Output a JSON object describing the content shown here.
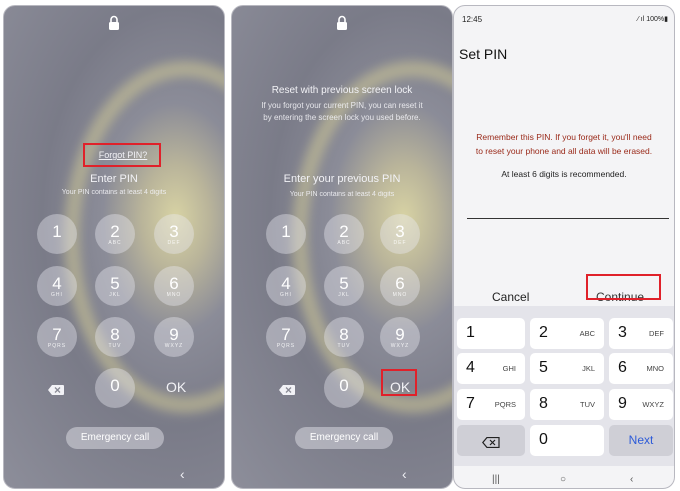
{
  "screen1": {
    "forgot_pin": "Forgot PIN?",
    "enter_pin": "Enter PIN",
    "pin_desc": "Your PIN contains at least 4 digits",
    "keys": [
      {
        "num": "1",
        "letters": ""
      },
      {
        "num": "2",
        "letters": "ABC"
      },
      {
        "num": "3",
        "letters": "DEF"
      },
      {
        "num": "4",
        "letters": "GHI"
      },
      {
        "num": "5",
        "letters": "JKL"
      },
      {
        "num": "6",
        "letters": "MNO"
      },
      {
        "num": "7",
        "letters": "PQRS"
      },
      {
        "num": "8",
        "letters": "TUV"
      },
      {
        "num": "9",
        "letters": "WXYZ"
      },
      {
        "num": "0",
        "letters": ""
      }
    ],
    "ok": "OK",
    "emergency": "Emergency call",
    "back": "‹"
  },
  "screen2": {
    "reset_title": "Reset with previous screen lock",
    "reset_desc_1": "If you forgot your current PIN, you can reset it",
    "reset_desc_2": "by entering the screen lock you used before.",
    "enter_prev": "Enter your previous PIN",
    "pin_desc": "Your PIN contains at least 4 digits",
    "keys": [
      {
        "num": "1",
        "letters": ""
      },
      {
        "num": "2",
        "letters": "ABC"
      },
      {
        "num": "3",
        "letters": "DEF"
      },
      {
        "num": "4",
        "letters": "GHI"
      },
      {
        "num": "5",
        "letters": "JKL"
      },
      {
        "num": "6",
        "letters": "MNO"
      },
      {
        "num": "7",
        "letters": "PQRS"
      },
      {
        "num": "8",
        "letters": "TUV"
      },
      {
        "num": "9",
        "letters": "WXYZ"
      },
      {
        "num": "0",
        "letters": ""
      }
    ],
    "ok": "OK",
    "emergency": "Emergency call",
    "back": "‹"
  },
  "screen3": {
    "time": "12:45",
    "status_right": "⁄ ıl 100%▮",
    "title": "Set PIN",
    "warning_line1": "Remember this PIN. If you forget it, you'll need",
    "warning_line2": "to reset your phone and all data will be erased.",
    "hint": "At least 6 digits is recommended.",
    "cancel": "Cancel",
    "continue": "Continue",
    "keys": [
      {
        "num": "1",
        "letters": ""
      },
      {
        "num": "2",
        "letters": "ABC"
      },
      {
        "num": "3",
        "letters": "DEF"
      },
      {
        "num": "4",
        "letters": "GHI"
      },
      {
        "num": "5",
        "letters": "JKL"
      },
      {
        "num": "6",
        "letters": "MNO"
      },
      {
        "num": "7",
        "letters": "PQRS"
      },
      {
        "num": "8",
        "letters": "TUV"
      },
      {
        "num": "9",
        "letters": "WXYZ"
      },
      {
        "num": "0",
        "letters": ""
      }
    ],
    "next": "Next",
    "nav": [
      "|||",
      "○",
      "‹"
    ]
  },
  "colors": {
    "highlight": "#e0212a",
    "next_key": "#2d5bd8",
    "warning_text": "#9a2a1a"
  }
}
